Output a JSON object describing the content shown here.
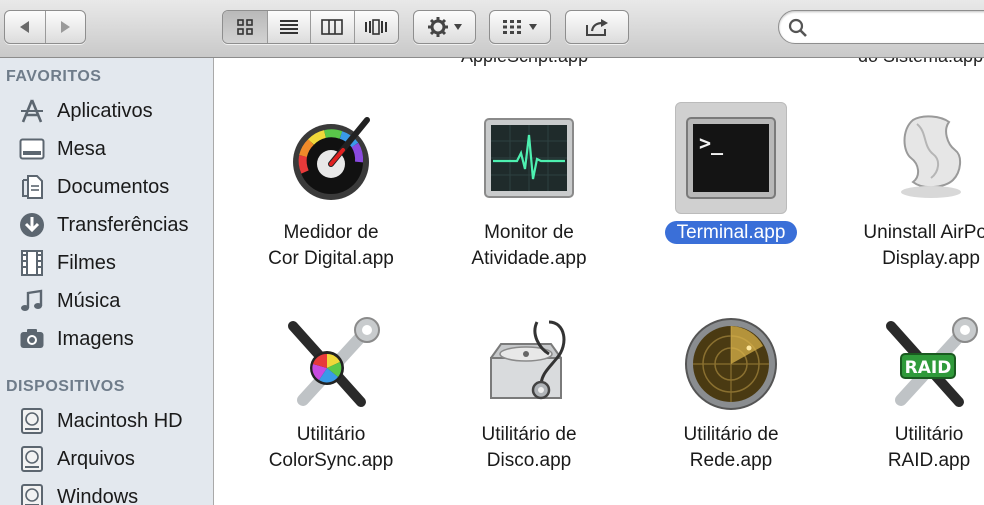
{
  "toolbar": {
    "nav": [
      "back-icon",
      "forward-icon"
    ],
    "views": [
      "icon-view",
      "list-view",
      "column-view",
      "coverflow-view"
    ],
    "active_view": 0,
    "search": {
      "value": "",
      "placeholder": ""
    }
  },
  "sidebar": {
    "favorites_title": "FAVORITOS",
    "favorites": [
      {
        "label": "Aplicativos",
        "icon": "applications-icon"
      },
      {
        "label": "Mesa",
        "icon": "desktop-icon"
      },
      {
        "label": "Documentos",
        "icon": "documents-icon"
      },
      {
        "label": "Transferências",
        "icon": "downloads-icon"
      },
      {
        "label": "Filmes",
        "icon": "movies-icon"
      },
      {
        "label": "Música",
        "icon": "music-icon"
      },
      {
        "label": "Imagens",
        "icon": "pictures-icon"
      }
    ],
    "devices_title": "DISPOSITIVOS",
    "devices": [
      {
        "label": "Macintosh HD",
        "icon": "disk-icon"
      },
      {
        "label": "Arquivos",
        "icon": "disk-icon"
      },
      {
        "label": "Windows",
        "icon": "disk-icon"
      }
    ]
  },
  "content": {
    "cut_labels": [
      "AppleScript.app",
      "do Sistema.app"
    ],
    "apps": [
      {
        "line1": "Medidor de",
        "line2": "Cor Digital.app",
        "icon": "color-meter-icon",
        "selected": false
      },
      {
        "line1": "Monitor de",
        "line2": "Atividade.app",
        "icon": "activity-monitor-icon",
        "selected": false
      },
      {
        "line1": "Terminal.app",
        "line2": "",
        "icon": "terminal-icon",
        "selected": true
      },
      {
        "line1": "Uninstall AirPort",
        "line2": "Display.app",
        "icon": "uninstall-icon",
        "selected": false
      },
      {
        "line1": "Utilitário",
        "line2": "ColorSync.app",
        "icon": "colorsync-icon",
        "selected": false
      },
      {
        "line1": "Utilitário de",
        "line2": "Disco.app",
        "icon": "disk-utility-icon",
        "selected": false
      },
      {
        "line1": "Utilitário de",
        "line2": "Rede.app",
        "icon": "network-utility-icon",
        "selected": false
      },
      {
        "line1": "Utilitário",
        "line2": "RAID.app",
        "icon": "raid-utility-icon",
        "selected": false
      }
    ],
    "terminal_prompt": ">_",
    "raid_badge": "RAID"
  }
}
